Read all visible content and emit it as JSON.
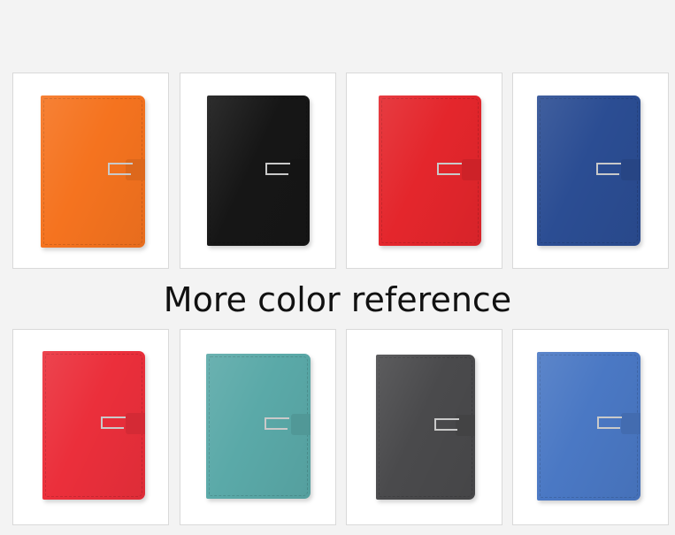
{
  "caption": "More color reference",
  "notebooks": [
    {
      "color_name": "orange",
      "color": "#f5731f"
    },
    {
      "color_name": "black",
      "color": "#161616"
    },
    {
      "color_name": "red",
      "color": "#e4262c"
    },
    {
      "color_name": "blue",
      "color": "#2b4d93"
    },
    {
      "color_name": "rose-red",
      "color": "#eb2f3b"
    },
    {
      "color_name": "teal",
      "color": "#5aa9a8"
    },
    {
      "color_name": "dark-gray",
      "color": "#4a4a4c"
    },
    {
      "color_name": "light-blue",
      "color": "#4a78c4"
    }
  ]
}
